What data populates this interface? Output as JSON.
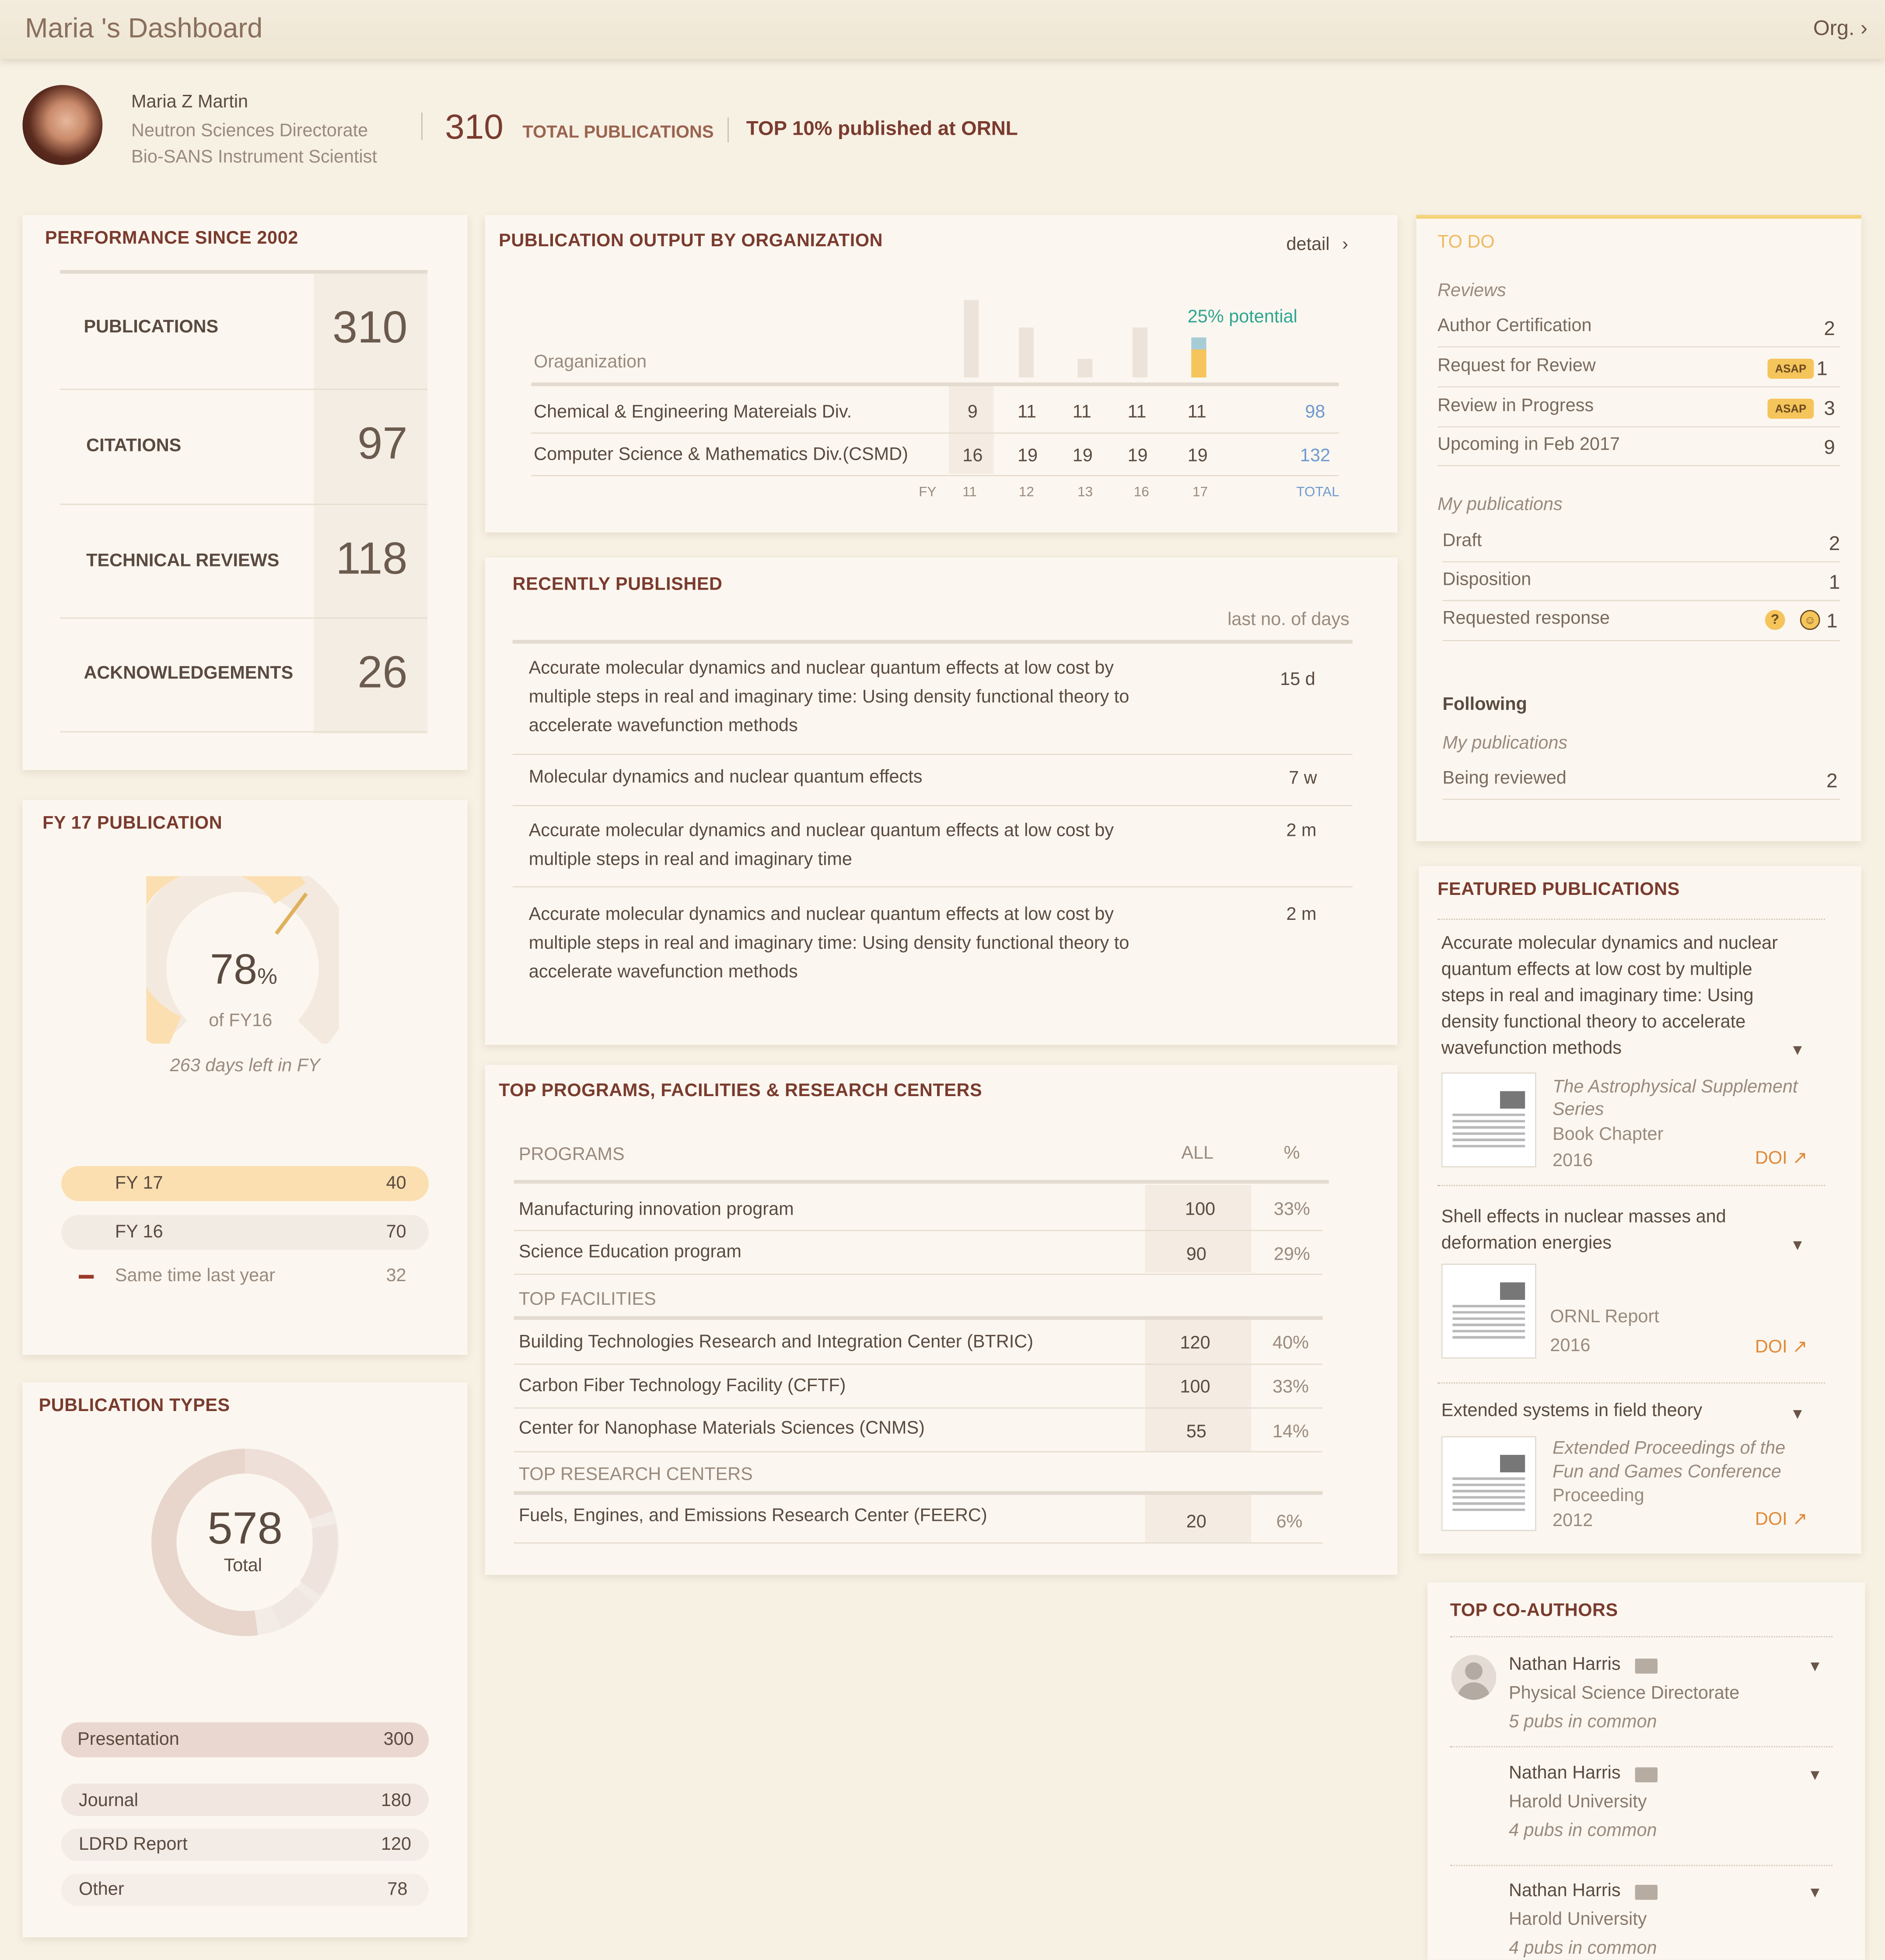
{
  "header": {
    "title": "Maria 's Dashboard",
    "org_label": "Org."
  },
  "profile": {
    "name": "Maria Z Martin",
    "directorate": "Neutron Sciences Directorate",
    "position": "Bio-SANS Instrument Scientist",
    "total_pubs": "310",
    "total_label": "TOTAL PUBLICATIONS",
    "rank": "TOP 10% published at ORNL"
  },
  "performance": {
    "title": "PERFORMANCE SINCE 2002",
    "rows": [
      {
        "label": "PUBLICATIONS",
        "value": "310"
      },
      {
        "label": "CITATIONS",
        "value": "97"
      },
      {
        "label": "TECHNICAL REVIEWS",
        "value": "118"
      },
      {
        "label": "ACKNOWLEDGEMENTS",
        "value": "26"
      }
    ]
  },
  "fy17": {
    "title": "FY 17 PUBLICATION",
    "percent": "78",
    "percent_sign": "%",
    "of_label": "of FY16",
    "days_left": "263 days left in FY",
    "rows": [
      {
        "label": "FY 17",
        "value": "40"
      },
      {
        "label": "FY 16",
        "value": "70"
      },
      {
        "label": "Same time last year",
        "value": "32"
      }
    ]
  },
  "pubtypes": {
    "title": "PUBLICATION TYPES",
    "total": "578",
    "total_label": "Total",
    "rows": [
      {
        "label": "Presentation",
        "value": "300"
      },
      {
        "label": "Journal",
        "value": "180"
      },
      {
        "label": "LDRD Report",
        "value": "120"
      },
      {
        "label": "Other",
        "value": "78"
      }
    ]
  },
  "output": {
    "title": "PUBLICATION OUTPUT BY ORGANIZATION",
    "detail": "detail",
    "potential": "25% potential",
    "org_header": "Oraganization",
    "years": [
      "11",
      "12",
      "13",
      "16",
      "17"
    ],
    "fy_label": "FY",
    "total_label": "TOTAL",
    "bar_values": [
      62,
      40,
      15,
      40,
      32
    ],
    "rows": [
      {
        "org": "Chemical & Engineering Matereials Div.",
        "values": [
          "9",
          "11",
          "11",
          "11",
          "11"
        ],
        "total": "98"
      },
      {
        "org": "Computer Science & Mathematics Div.(CSMD)",
        "values": [
          "16",
          "19",
          "19",
          "19",
          "19"
        ],
        "total": "132"
      }
    ]
  },
  "recent": {
    "title": "RECENTLY PUBLISHED",
    "col_header": "last no. of days",
    "items": [
      {
        "lines": [
          "Accurate molecular dynamics and nuclear quantum effects at low cost by",
          "multiple steps in real and imaginary time: Using density functional theory to",
          "accelerate wavefunction methods"
        ],
        "age": "15 d"
      },
      {
        "lines": [
          "Molecular dynamics and nuclear quantum effects"
        ],
        "age": "7 w"
      },
      {
        "lines": [
          "Accurate molecular dynamics and nuclear quantum effects at low cost by",
          "multiple steps in real and imaginary time"
        ],
        "age": "2 m"
      },
      {
        "lines": [
          "Accurate molecular dynamics and nuclear quantum effects at low cost by",
          "multiple steps in real and imaginary time: Using density functional theory to",
          "accelerate wavefunction methods"
        ],
        "age": "2 m"
      }
    ]
  },
  "programs": {
    "title": "TOP PROGRAMS, FACILITIES & RESEARCH CENTERS",
    "col_all": "ALL",
    "col_pct": "%",
    "sections": [
      {
        "header": "PROGRAMS",
        "rows": [
          {
            "name": "Manufacturing innovation program",
            "all": "100",
            "pct": "33%"
          },
          {
            "name": "Science Education program",
            "all": "90",
            "pct": "29%"
          }
        ]
      },
      {
        "header": "TOP FACILITIES",
        "rows": [
          {
            "name": "Building Technologies Research and Integration Center (BTRIC)",
            "all": "120",
            "pct": "40%"
          },
          {
            "name": "Carbon Fiber Technology Facility (CFTF)",
            "all": "100",
            "pct": "33%"
          },
          {
            "name": "Center for Nanophase Materials Sciences (CNMS)",
            "all": "55",
            "pct": "14%"
          }
        ]
      },
      {
        "header": "TOP RESEARCH CENTERS",
        "rows": [
          {
            "name": "Fuels, Engines, and Emissions Research Center (FEERC)",
            "all": "20",
            "pct": "6%"
          }
        ]
      }
    ]
  },
  "todo": {
    "title": "TO DO",
    "reviews_header": "Reviews",
    "reviews": [
      {
        "label": "Author Certification",
        "count": "2"
      },
      {
        "label": "Request for Review",
        "badge": "ASAP",
        "count": "1"
      },
      {
        "label": "Review in Progress",
        "badge": "ASAP",
        "count": "3"
      },
      {
        "label": "Upcoming in Feb 2017",
        "count": "9"
      }
    ],
    "mypubs_header": "My publications",
    "mypubs": [
      {
        "label": "Draft",
        "count": "2"
      },
      {
        "label": "Disposition",
        "count": "1"
      },
      {
        "label": "Requested response",
        "count": "1",
        "q": "?"
      }
    ],
    "following_header": "Following",
    "following_sub": "My publications",
    "following": [
      {
        "label": "Being reviewed",
        "count": "2"
      }
    ]
  },
  "featured": {
    "title": "FEATURED PUBLICATIONS",
    "doi_label": "DOI ↗",
    "items": [
      {
        "lines": [
          "Accurate molecular dynamics and nuclear",
          "quantum effects at low cost by multiple",
          "steps in real and imaginary time: Using",
          "density functional theory to accelerate",
          "wavefunction methods"
        ],
        "source": [
          "The Astrophysical Supplement",
          "Series"
        ],
        "type": "Book Chapter",
        "year": "2016"
      },
      {
        "lines": [
          "Shell effects in nuclear masses and",
          "deformation energies"
        ],
        "source": [],
        "type": "ORNL Report",
        "year": "2016"
      },
      {
        "lines": [
          "Extended systems in field theory"
        ],
        "source": [
          "Extended Proceedings of the",
          "Fun and Games Conference"
        ],
        "type": "Proceeding",
        "year": "2012"
      }
    ]
  },
  "coauthors": {
    "title": "TOP CO-AUTHORS",
    "items": [
      {
        "name": "Nathan Harris",
        "org": "Physical Science Directorate",
        "common": "5 pubs in common"
      },
      {
        "name": "Nathan Harris",
        "org": "Harold University",
        "common": "4 pubs in common"
      },
      {
        "name": "Nathan Harris",
        "org": "Harold University",
        "common": "4 pubs in common"
      }
    ]
  },
  "colors": {
    "accent": "#7a3b2e",
    "yellow": "#f5c45a",
    "peach": "#fbe0b4",
    "link": "#6e9ad0",
    "teal": "#2fa58f",
    "bg": "#f7f1e4"
  }
}
